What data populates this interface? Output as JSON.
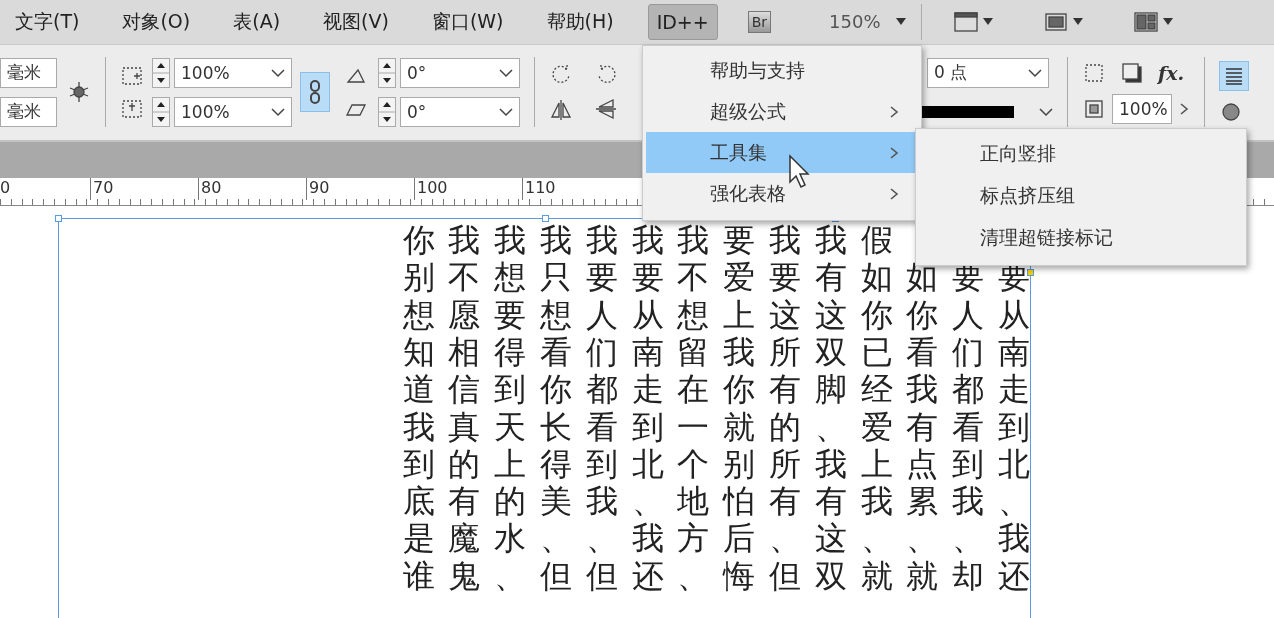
{
  "menubar": {
    "items": [
      {
        "label": "文字(T)",
        "selected": false
      },
      {
        "label": "对象(O)",
        "selected": false
      },
      {
        "label": "表(A)",
        "selected": false
      },
      {
        "label": "视图(V)",
        "selected": false
      },
      {
        "label": "窗口(W)",
        "selected": false
      },
      {
        "label": "帮助(H)",
        "selected": false
      },
      {
        "label": "ID++",
        "selected": true
      }
    ],
    "bridge": "Br",
    "zoom": "150%"
  },
  "toolbar": {
    "units": [
      "毫米",
      "毫米"
    ],
    "scales": [
      "100%",
      "100%"
    ],
    "link": {
      "selected": true
    },
    "angles": [
      "0°",
      "0°"
    ],
    "stroke": "0 点",
    "opacity": "100%",
    "fx": "fx.",
    "wrap": {
      "selected": true
    }
  },
  "ruler": {
    "labels": [
      "0",
      "70",
      "80",
      "90",
      "100",
      "110"
    ]
  },
  "menu": {
    "items": [
      {
        "label": "帮助与支持",
        "has_submenu": false,
        "selected": false
      },
      {
        "label": "超级公式",
        "has_submenu": true,
        "selected": false
      },
      {
        "label": "工具集",
        "has_submenu": true,
        "selected": true
      },
      {
        "label": "强化表格",
        "has_submenu": true,
        "selected": false
      }
    ],
    "submenu": [
      "正向竖排",
      "标点挤压组",
      "清理超链接标记"
    ]
  },
  "document": {
    "columns": [
      {
        "text": "你别想知道我到底是谁"
      },
      {
        "text": "我不愿相信真的有魔鬼"
      },
      {
        "text": "我想要得到天上的水、"
      },
      {
        "text": "我只想看你长得美、但"
      },
      {
        "text": "我要人们都看到我、但"
      },
      {
        "text": "我要从南走到北、我还"
      },
      {
        "text": "我不想留在一个地方、"
      },
      {
        "text": "要爱上我你就别怕后悔"
      },
      {
        "text": "我要这所有的所有、但"
      },
      {
        "text": "我有这双脚、我有这双"
      },
      {
        "text": "假如你已经爱上我、就"
      },
      {
        "text": "如你看我有点累、就"
      },
      {
        "text": "要人们都看到我、却"
      },
      {
        "text": "要从南走到北、我还"
      }
    ]
  }
}
